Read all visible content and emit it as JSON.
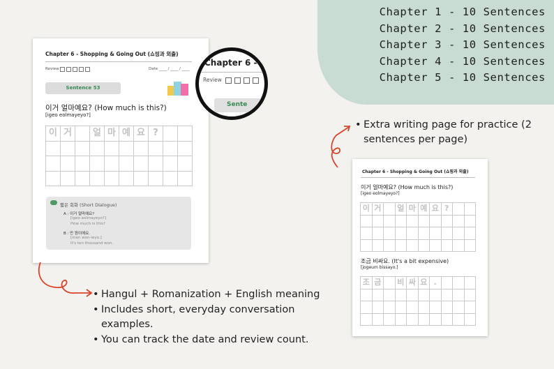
{
  "chapters": [
    "Chapter 1 - 10 Sentences",
    "Chapter 2 - 10 Sentences",
    "Chapter 3 - 10 Sentences",
    "Chapter 4 - 10 Sentences",
    "Chapter 5 - 10 Sentences"
  ],
  "sheet1": {
    "chapter_title": "Chapter 6 - Shopping & Going Out (쇼핑과 외출)",
    "review_label": "Review",
    "date_label": "Date ____ / ____ / ____",
    "sentence_pill": "Sentence 53",
    "sentence": "이거 얼마예요? (How much is this?)",
    "romanization": "[igeo eolmayeyo?]",
    "grid_chars": [
      "이",
      "거",
      "",
      "얼",
      "마",
      "예",
      "요",
      "?",
      "",
      ""
    ],
    "dialogue": {
      "heading": "짧은 회화 (Short Dialogue)",
      "a_line": "A : 이거 얼마예요?",
      "a_rom": "[igeo eolmayeyo?]",
      "a_en": "How much is this?",
      "b_line": "B : 만 원이에요.",
      "b_rom": "[man won-ieyo.]",
      "b_en": "It's ten thousand won."
    }
  },
  "magnifier": {
    "title": "Chapter 6 - Sh",
    "review_label": "Review",
    "pill": "Sente"
  },
  "sheet2": {
    "chapter_title": "Chapter 6 - Shopping & Going Out (쇼핑과 외출)",
    "sentence1": "이거 얼마예요? (How much is this?)",
    "rom1": "[igeo eolmayeyo?]",
    "grid1_chars": [
      "이",
      "거",
      "",
      "얼",
      "마",
      "예",
      "요",
      "?",
      "",
      ""
    ],
    "sentence2": "조금 비싸요. (It's a bit expensive)",
    "rom2": "[jogeum bissayo.]",
    "grid2_chars": [
      "조",
      "금",
      "",
      "비",
      "싸",
      "요",
      ".",
      "",
      "",
      ""
    ]
  },
  "bullets_left": [
    "Hangul + Romanization + English meaning",
    "Includes short, everyday conversation examples.",
    "You can track the date and review count."
  ],
  "bullets_right": [
    "Extra writing page for practice (2 sentences per page)"
  ],
  "colors": {
    "accent_green": "#3a8a55",
    "blob": "#c8dcd3",
    "arrow_red": "#d9442b"
  }
}
